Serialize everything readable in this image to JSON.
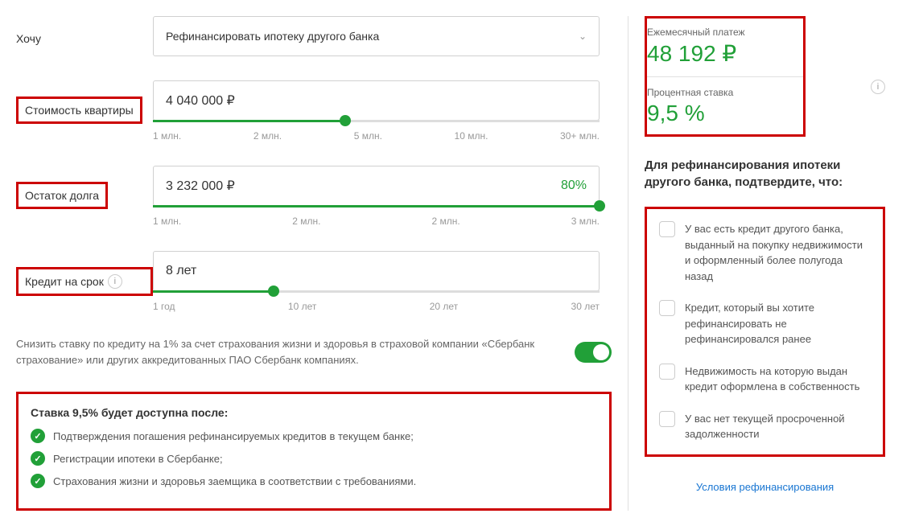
{
  "left": {
    "want": {
      "label": "Хочу",
      "value": "Рефинансировать ипотеку другого банка"
    },
    "cost": {
      "label": "Стоимость квартиры",
      "value": "4 040 000 ₽",
      "ticks": [
        "1 млн.",
        "2 млн.",
        "5 млн.",
        "10 млн.",
        "30+ млн."
      ],
      "fill_pct": 43
    },
    "debt": {
      "label": "Остаток долга",
      "value": "3 232 000 ₽",
      "pct": "80%",
      "ticks": [
        "1 млн.",
        "2 млн.",
        "2 млн.",
        "3 млн."
      ],
      "fill_pct": 100
    },
    "term": {
      "label": "Кредит на срок",
      "value": "8 лет",
      "ticks": [
        "1 год",
        "10 лет",
        "20 лет",
        "30 лет"
      ],
      "fill_pct": 27
    },
    "insurance": "Снизить ставку по кредиту на 1% за счет страхования жизни и здоровья в страховой компании «Сбербанк страхование» или других аккредитованных ПАО Сбербанк компаниях.",
    "rate": {
      "title": "Ставка 9,5% будет доступна после:",
      "items": [
        "Подтверждения погашения рефинансируемых кредитов в текущем банке;",
        "Регистрации ипотеки в Сбербанке;",
        "Страхования жизни и здоровья заемщика в соответствии с требованиями."
      ]
    }
  },
  "right": {
    "payment": {
      "label": "Ежемесячный платеж",
      "value": "48 192 ₽"
    },
    "rate": {
      "label": "Процентная ставка",
      "value": "9,5 %"
    },
    "confirm_title": "Для рефинансирования ипотеки другого банка, подтвердите, что:",
    "checklist": [
      "У вас есть кредит другого банка, выданный на покупку недвижимости и оформленный более полугода назад",
      "Кредит, который вы хотите рефинансировать не рефинансировался ранее",
      "Недвижимость на которую выдан кредит оформлена в собственность",
      "У вас нет текущей просроченной задолженности"
    ],
    "terms_link": "Условия рефинансирования"
  }
}
